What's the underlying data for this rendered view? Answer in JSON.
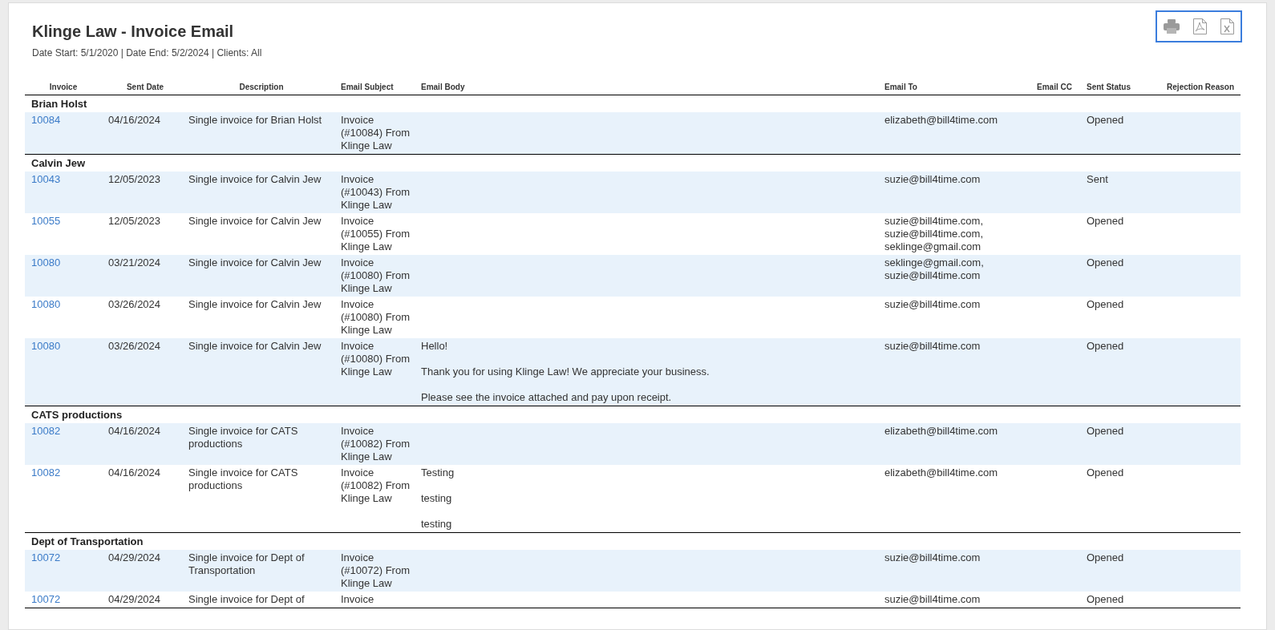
{
  "report": {
    "title": "Klinge Law - Invoice Email",
    "filters": "Date Start: 5/1/2020 | Date End: 5/2/2024 | Clients: All"
  },
  "columns": [
    "Invoice",
    "Sent Date",
    "Description",
    "Email Subject",
    "Email Body",
    "Email To",
    "Email CC",
    "Sent Status",
    "Rejection Reason"
  ],
  "groups": [
    {
      "client": "Brian Holst",
      "rows": [
        {
          "invoice": "10084",
          "sent_date": "04/16/2024",
          "description": "Single invoice for Brian Holst",
          "subject": "Invoice (#10084) From Klinge Law",
          "email_to": [
            "elizabeth@bill4time.com"
          ],
          "sent_status": "Opened"
        }
      ]
    },
    {
      "client": "Calvin Jew",
      "rows": [
        {
          "invoice": "10043",
          "sent_date": "12/05/2023",
          "description": "Single invoice for Calvin Jew",
          "subject": "Invoice (#10043) From Klinge Law",
          "email_to": [
            "suzie@bill4time.com"
          ],
          "sent_status": "Sent"
        },
        {
          "invoice": "10055",
          "sent_date": "12/05/2023",
          "description": "Single invoice for Calvin Jew",
          "subject": "Invoice (#10055) From Klinge Law",
          "email_to": [
            "suzie@bill4time.com,",
            "suzie@bill4time.com,",
            "seklinge@gmail.com"
          ],
          "sent_status": "Opened"
        },
        {
          "invoice": "10080",
          "sent_date": "03/21/2024",
          "description": "Single invoice for Calvin Jew",
          "subject": "Invoice (#10080) From Klinge Law",
          "email_to": [
            "seklinge@gmail.com,",
            "suzie@bill4time.com"
          ],
          "sent_status": "Opened"
        },
        {
          "invoice": "10080",
          "sent_date": "03/26/2024",
          "description": "Single invoice for Calvin Jew",
          "subject": "Invoice (#10080) From Klinge Law",
          "email_to": [
            "suzie@bill4time.com"
          ],
          "sent_status": "Opened"
        },
        {
          "invoice": "10080",
          "sent_date": "03/26/2024",
          "description": "Single invoice for Calvin Jew",
          "subject": "Invoice (#10080) From Klinge Law",
          "body": [
            "Hello!",
            "Thank you for using Klinge Law! We appreciate your business.",
            "Please see the invoice attached and pay upon receipt."
          ],
          "email_to": [
            "suzie@bill4time.com"
          ],
          "sent_status": "Opened"
        }
      ]
    },
    {
      "client": "CATS productions",
      "rows": [
        {
          "invoice": "10082",
          "sent_date": "04/16/2024",
          "description": "Single invoice for CATS productions",
          "subject": "Invoice (#10082) From Klinge Law",
          "email_to": [
            "elizabeth@bill4time.com"
          ],
          "sent_status": "Opened"
        },
        {
          "invoice": "10082",
          "sent_date": "04/16/2024",
          "description": "Single invoice for CATS productions",
          "subject": "Invoice (#10082) From Klinge Law",
          "body": [
            "Testing",
            "testing",
            "testing"
          ],
          "email_to": [
            "elizabeth@bill4time.com"
          ],
          "sent_status": "Opened"
        }
      ]
    },
    {
      "client": "Dept of Transportation",
      "rows": [
        {
          "invoice": "10072",
          "sent_date": "04/29/2024",
          "description": "Single invoice for Dept of Transportation",
          "subject": "Invoice (#10072) From Klinge Law",
          "email_to": [
            "suzie@bill4time.com"
          ],
          "sent_status": "Opened"
        },
        {
          "invoice": "10072",
          "sent_date": "04/29/2024",
          "description": "Single invoice for Dept of",
          "subject": "Invoice",
          "email_to": [
            "suzie@bill4time.com"
          ],
          "sent_status": "Opened"
        }
      ]
    }
  ]
}
